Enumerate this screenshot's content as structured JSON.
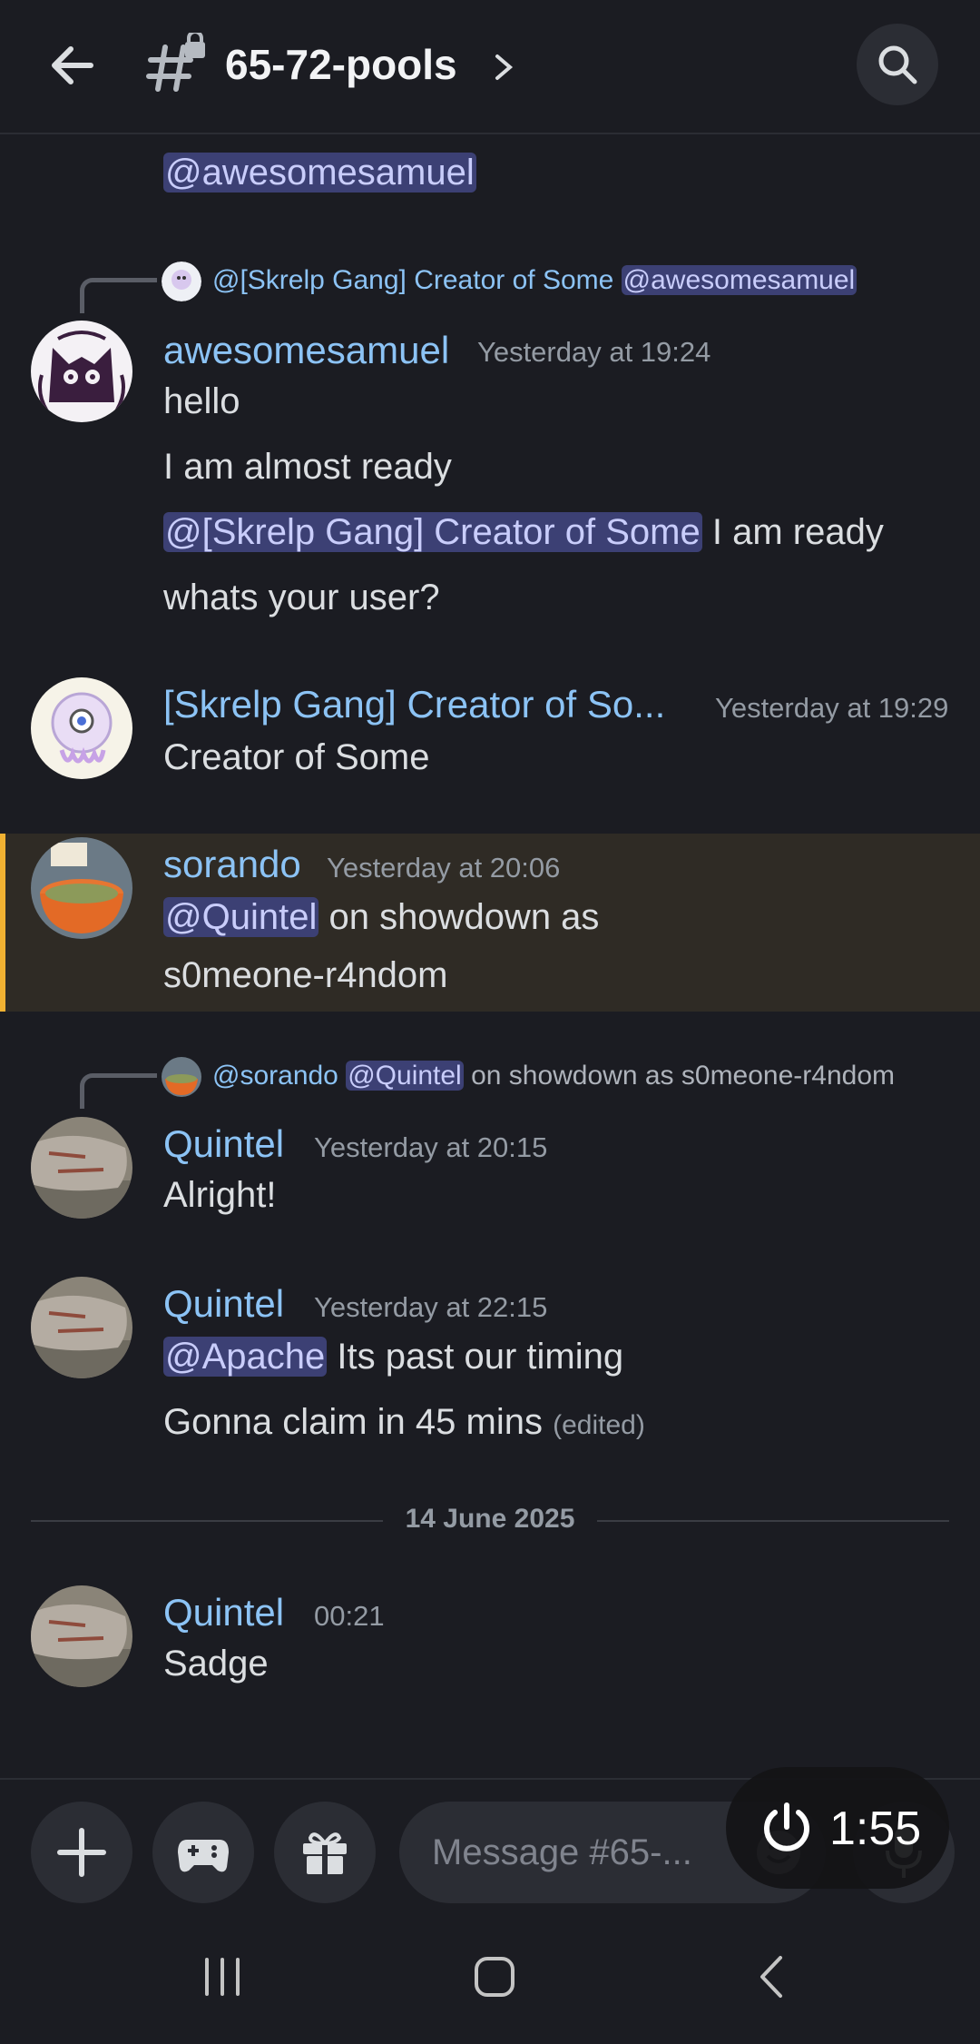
{
  "header": {
    "channel_name": "65-72-pools"
  },
  "messages": {
    "top_partial": {
      "mention": "@awesomesamuel"
    },
    "m1": {
      "reply": {
        "name": "@[Skrelp Gang] Creator of Some",
        "mention": "@awesomesamuel"
      },
      "username": "awesomesamuel",
      "timestamp": "Yesterday at 19:24",
      "lines": {
        "l1": "hello",
        "l2": "I am almost ready",
        "l3_mention": "@[Skrelp Gang] Creator of Some",
        "l3_text": " I am ready",
        "l4": "whats your user?"
      }
    },
    "m2": {
      "username": "[Skrelp Gang] Creator of So...",
      "timestamp": "Yesterday at 19:29",
      "text": "Creator of Some"
    },
    "m3": {
      "username": "sorando",
      "timestamp": "Yesterday at 20:06",
      "mention": "@Quintel",
      "text1": " on showdown as",
      "text2": "s0meone-r4ndom"
    },
    "m4": {
      "reply": {
        "name": "@sorando",
        "mention": "@Quintel",
        "text": " on showdown as s0meone-r4ndom"
      },
      "username": "Quintel",
      "timestamp": "Yesterday at 20:15",
      "text": "Alright!"
    },
    "m5": {
      "username": "Quintel",
      "timestamp": "Yesterday at 22:15",
      "mention": "@Apache",
      "text1": " Its past our timing",
      "text2": "Gonna claim in 45 mins",
      "edited": "(edited)"
    },
    "date_divider": "14 June 2025",
    "m6": {
      "username": "Quintel",
      "timestamp": "00:21",
      "text": "Sadge"
    }
  },
  "composer": {
    "placeholder": "Message #65-..."
  },
  "timer": {
    "value": "1:55"
  },
  "colors": {
    "background": "#1b1c22",
    "username": "#8cc3f5",
    "mention_bg": "#3c4074",
    "highlight_stripe": "#f0b132"
  }
}
